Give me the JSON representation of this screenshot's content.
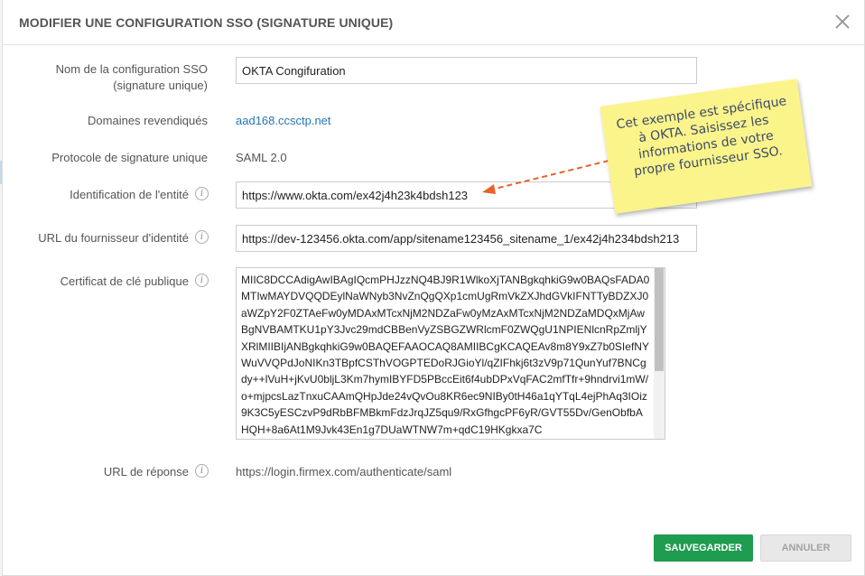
{
  "dialog": {
    "title": "MODIFIER UNE CONFIGURATION SSO (SIGNATURE UNIQUE)",
    "close_icon": "close-icon"
  },
  "fields": {
    "config_name": {
      "label": "Nom de la configuration SSO (signature unique)",
      "value": "OKTA Congifuration"
    },
    "domains": {
      "label": "Domaines revendiqués",
      "value": "aad168.ccsctp.net"
    },
    "protocol": {
      "label": "Protocole de signature unique",
      "value": "SAML 2.0"
    },
    "entity_id": {
      "label": "Identification de l'entité",
      "value": "https://www.okta.com/ex42j4h23k4bdsh123"
    },
    "idp_url": {
      "label": "URL du fournisseur d'identité",
      "value": "https://dev-123456.okta.com/app/sitename123456_sitename_1/ex42j4h234bdsh213"
    },
    "certificate": {
      "label": "Certificat de clé publique",
      "value": "MIIC8DCCAdigAwIBAgIQcmPHJzzNQ4BJ9R1WlkoXjTANBgkqhkiG9w0BAQsFADA0MTIwMAYDVQQDEylNaWNyb3NvZnQgQXp1cmUgRmVkZXJhdGVkIFNTTyBDZXJ0aWZpY2F0ZTAeFw0yMDAxMTcxNjM2NDZaFw0yMzAxMTcxNjM2NDZaMDQxMjAwBgNVBAMTKU1pY3Jvc29mdCBBenVyZSBGZWRlcmF0ZWQgU1NPIENlcnRpZmljYXRlMIIBIjANBgkqhkiG9w0BAQEFAAOCAQ8AMIIBCgKCAQEAv8m8Y9xZ7b0SIefNYWuVVQPdJoNIKn3TBpfCSThVOGPTEDoRJGioYl/qZIFhkj6t3zV9p71QunYuf7BNCgdy++lVuH+jKvU0bljL3Km7hymIBYFD5PBccEit6f4ubDPxVqFAC2mfTfr+9hndrvi1mW/o+mjpcsLazTnxuCAAmQHpJde24vQvOu8KR6ec9NIBy0tH46a1qYTqL4ejPhAq3IOiz9K3C5yESCzvP9dRbBFMBkmFdzJrqJZ5qu9/RxGfhgcPF6yR/GVT55Dv/GenObfbAHQH+8a6At1M9Jvk43En1g7DUaWTNW7m+qdC19HKgkxa7C"
    },
    "reply_url": {
      "label": "URL de réponse",
      "value": "https://login.firmex.com/authenticate/saml"
    }
  },
  "info_icon": "info-icon",
  "note": {
    "text": "Cet exemple est spécifique à OKTA. Saisissez les informations de votre propre fournisseur SSO."
  },
  "buttons": {
    "save": "SAUVEGARDER",
    "cancel": "ANNULER"
  },
  "colors": {
    "save_green": "#1e9c50",
    "link_blue": "#2577b7",
    "note_yellow": "#fbf48a",
    "arrow_orange": "#e8622a"
  }
}
